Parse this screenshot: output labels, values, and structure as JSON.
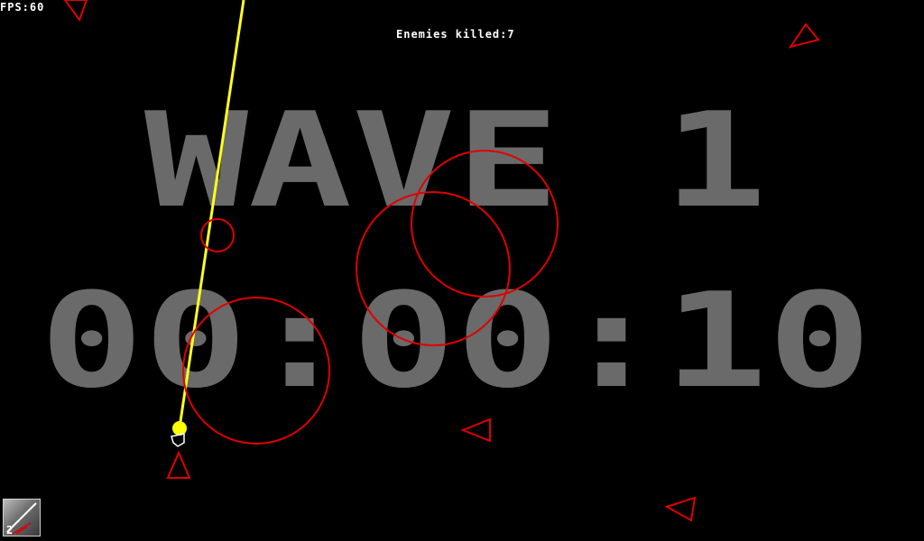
{
  "hud": {
    "fps_label": "FPS:60",
    "enemies_label": "Enemies killed:7"
  },
  "banner": {
    "wave_text": "WAVE 1",
    "timer_text": "00:00:10"
  },
  "weapon": {
    "icon": "laser-weapon-icon",
    "count": "2"
  },
  "colors": {
    "background": "#000000",
    "enemy": "#ff0000",
    "laser": "#ffff00",
    "player": "#ffffff",
    "banner": "#6a6a6a"
  }
}
